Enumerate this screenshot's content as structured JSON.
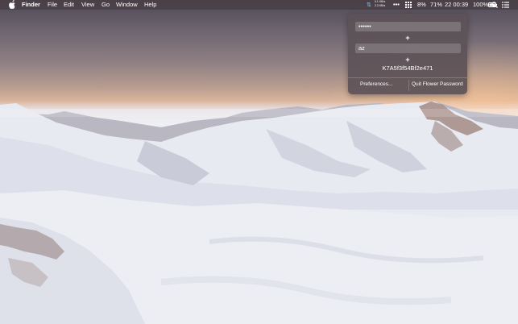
{
  "menubar": {
    "app_name": "Finder",
    "menus": [
      "File",
      "Edit",
      "View",
      "Go",
      "Window",
      "Help"
    ],
    "network": {
      "upload": "0.1 KB/s",
      "download": "2.3 KB/s"
    },
    "more_icon": "ellipsis-icon",
    "cpu_percent": "8%",
    "memory_percent": "71%",
    "clock": "22 00:39",
    "battery": "100%",
    "icons": [
      "apple-logo",
      "network-monitor",
      "ellipsis",
      "grid-app",
      "battery",
      "spotlight",
      "menu-list"
    ]
  },
  "popup": {
    "password_mask": "••••••",
    "plus_symbol_1": "+",
    "key_value": "az",
    "plus_symbol_2": "+",
    "result_hash": "K7A5f3f54Bf2e471",
    "preferences_label": "Preferences...",
    "quit_label": "Quit Flower Password"
  }
}
